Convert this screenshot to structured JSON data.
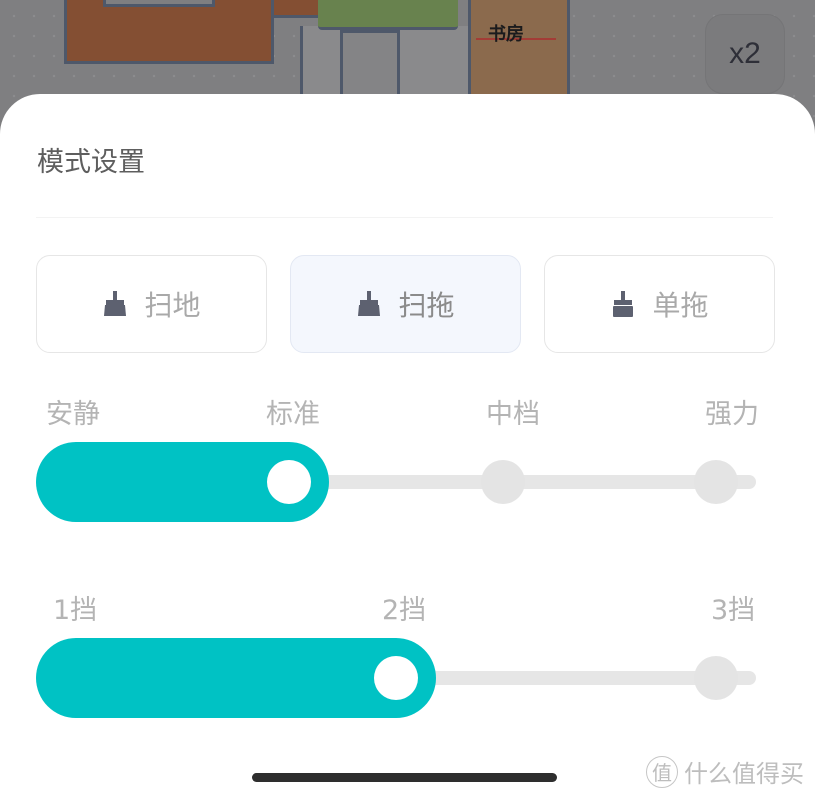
{
  "map": {
    "room_label": "书房",
    "zoom_label": "x2"
  },
  "sheet": {
    "title": "模式设置",
    "modes": [
      {
        "label": "扫地",
        "icon": "broom-icon",
        "selected": false
      },
      {
        "label": "扫拖",
        "icon": "broom-icon",
        "selected": true
      },
      {
        "label": "单拖",
        "icon": "mop-icon",
        "selected": false
      }
    ],
    "suction": {
      "stops": [
        "安静",
        "标准",
        "中档",
        "强力"
      ],
      "selected_index": 1,
      "selected_label": "标准"
    },
    "water": {
      "stops": [
        "1挡",
        "2挡",
        "3挡"
      ],
      "selected_index": 1,
      "selected_label": "2挡"
    }
  },
  "colors": {
    "accent": "#00c2c4",
    "track": "#e6e6e6",
    "selected_mode_bg": "#f4f7fd"
  },
  "watermark": {
    "logo": "值",
    "text": "什么值得买"
  }
}
